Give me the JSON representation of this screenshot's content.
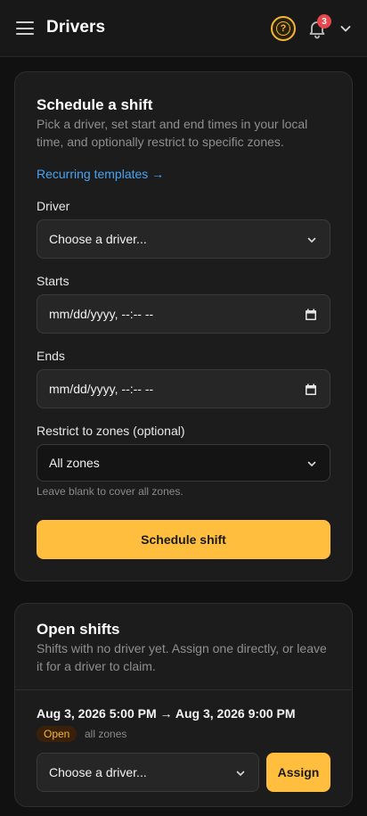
{
  "header": {
    "title": "Drivers",
    "notification_count": "3"
  },
  "schedule": {
    "title": "Schedule a shift",
    "subtitle": "Pick a driver, set start and end times in your local time, and optionally restrict to specific zones.",
    "templates_link": "Recurring templates →",
    "driver_label": "Driver",
    "driver_placeholder": "Choose a driver...",
    "starts_label": "Starts",
    "starts_value": "mm/dd/yyyy, --:-- --",
    "ends_label": "Ends",
    "ends_value": "mm/dd/yyyy, --:-- --",
    "zones_label": "Restrict to zones (optional)",
    "zones_value": "All zones",
    "zones_hint": "Leave blank to cover all zones.",
    "submit_label": "Schedule shift"
  },
  "open_shifts": {
    "title": "Open shifts",
    "subtitle": "Shifts with no driver yet. Assign one directly, or leave it for a driver to claim.",
    "items": [
      {
        "range": "Aug 3, 2026 5:00 PM → Aug 3, 2026 9:00 PM",
        "status": "Open",
        "zones": "all zones",
        "driver_placeholder": "Choose a driver...",
        "assign_label": "Assign"
      }
    ]
  },
  "colors": {
    "accent": "#ffbe3d",
    "link": "#4aa3f0",
    "badge": "#e5484d"
  }
}
